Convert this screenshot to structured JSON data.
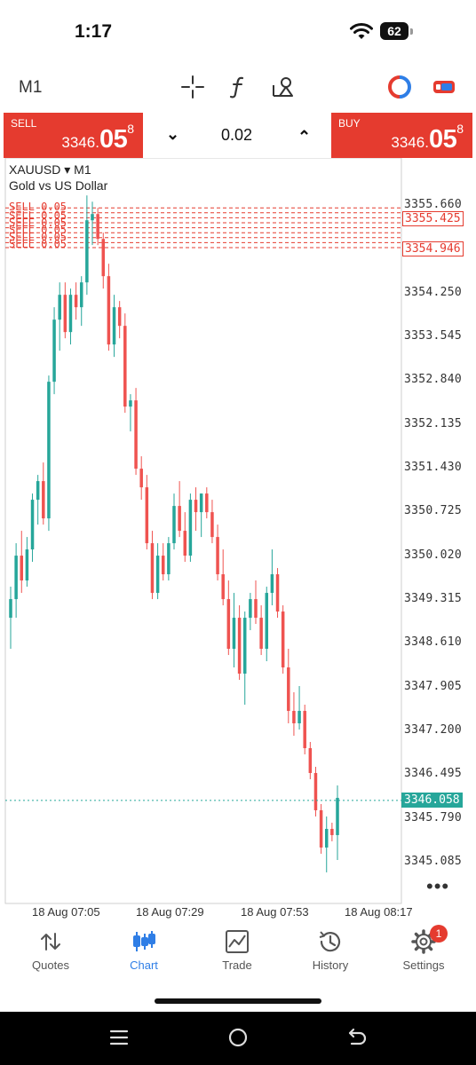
{
  "status": {
    "time": "1:17",
    "battery": "62"
  },
  "toolbar": {
    "timeframe": "M1",
    "icons": [
      "crosshair-icon",
      "function-icon",
      "objects-icon",
      "account-ring-icon",
      "toggle-icon"
    ]
  },
  "trade": {
    "sell": {
      "label": "SELL",
      "price_small": "3346.",
      "price_big": "05",
      "price_sup": "8"
    },
    "buy": {
      "label": "BUY",
      "price_small": "3346.",
      "price_big": "05",
      "price_sup": "8"
    },
    "volume": "0.02"
  },
  "chart": {
    "symbol": "XAUUSD",
    "timeframe": "M1",
    "description": "Gold vs US Dollar",
    "price_axis": [
      "3355.660",
      "3354.250",
      "3353.545",
      "3352.840",
      "3352.135",
      "3351.430",
      "3350.725",
      "3350.020",
      "3349.315",
      "3348.610",
      "3347.905",
      "3347.200",
      "3346.495",
      "3345.790",
      "3345.085"
    ],
    "order_lines": {
      "label": "SELL 0.05",
      "tags": [
        "3355.425",
        "3354.946"
      ]
    },
    "current_price": "3346.058",
    "time_axis": [
      "18 Aug 07:05",
      "18 Aug 07:29",
      "18 Aug 07:53",
      "18 Aug 08:17"
    ],
    "colors": {
      "up": "#26a69a",
      "down": "#ef5350",
      "order": "#e53b2f",
      "current": "#26a69a"
    }
  },
  "chart_data": {
    "type": "candlestick",
    "ylim": [
      3344.7,
      3356.0
    ],
    "candles": [
      [
        3349.0,
        3349.5,
        3348.5,
        3349.3
      ],
      [
        3349.3,
        3350.2,
        3349.0,
        3350.0
      ],
      [
        3350.0,
        3350.4,
        3349.4,
        3349.6
      ],
      [
        3349.6,
        3350.3,
        3349.5,
        3350.1
      ],
      [
        3350.1,
        3351.0,
        3349.9,
        3350.9
      ],
      [
        3350.9,
        3351.3,
        3350.5,
        3351.2
      ],
      [
        3351.2,
        3351.5,
        3350.5,
        3350.6
      ],
      [
        3350.6,
        3352.9,
        3350.4,
        3352.8
      ],
      [
        3352.8,
        3354.0,
        3352.6,
        3353.8
      ],
      [
        3353.8,
        3354.4,
        3353.3,
        3354.2
      ],
      [
        3354.2,
        3354.4,
        3353.5,
        3353.6
      ],
      [
        3353.6,
        3354.3,
        3353.4,
        3354.2
      ],
      [
        3354.2,
        3354.4,
        3353.8,
        3354.0
      ],
      [
        3354.0,
        3354.5,
        3353.7,
        3354.4
      ],
      [
        3354.4,
        3355.8,
        3354.2,
        3355.4
      ],
      [
        3355.4,
        3355.7,
        3355.0,
        3355.5
      ],
      [
        3355.5,
        3355.6,
        3355.0,
        3355.1
      ],
      [
        3355.1,
        3355.2,
        3354.3,
        3354.5
      ],
      [
        3354.5,
        3354.7,
        3353.3,
        3353.4
      ],
      [
        3353.4,
        3354.2,
        3353.2,
        3354.0
      ],
      [
        3354.0,
        3354.1,
        3353.5,
        3353.7
      ],
      [
        3353.7,
        3353.9,
        3352.3,
        3352.4
      ],
      [
        3352.4,
        3352.6,
        3352.0,
        3352.5
      ],
      [
        3352.5,
        3352.7,
        3351.3,
        3351.4
      ],
      [
        3351.4,
        3351.6,
        3350.9,
        3351.1
      ],
      [
        3351.1,
        3351.3,
        3350.1,
        3350.2
      ],
      [
        3350.2,
        3350.4,
        3349.3,
        3349.4
      ],
      [
        3349.4,
        3350.2,
        3349.3,
        3350.0
      ],
      [
        3350.0,
        3350.2,
        3349.6,
        3349.7
      ],
      [
        3349.7,
        3350.3,
        3349.6,
        3350.2
      ],
      [
        3350.2,
        3351.0,
        3350.1,
        3350.8
      ],
      [
        3350.8,
        3351.2,
        3350.3,
        3350.4
      ],
      [
        3350.4,
        3350.7,
        3349.9,
        3350.0
      ],
      [
        3350.0,
        3351.0,
        3349.9,
        3350.9
      ],
      [
        3350.9,
        3351.1,
        3350.4,
        3350.7
      ],
      [
        3350.7,
        3351.0,
        3350.3,
        3351.0
      ],
      [
        3351.0,
        3351.1,
        3350.6,
        3350.7
      ],
      [
        3350.7,
        3350.9,
        3350.2,
        3350.3
      ],
      [
        3350.3,
        3350.5,
        3349.6,
        3349.7
      ],
      [
        3349.7,
        3350.1,
        3349.2,
        3349.3
      ],
      [
        3349.3,
        3349.6,
        3348.4,
        3348.5
      ],
      [
        3348.5,
        3349.4,
        3348.2,
        3349.0
      ],
      [
        3349.0,
        3349.2,
        3348.0,
        3348.1
      ],
      [
        3348.1,
        3349.1,
        3347.6,
        3349.0
      ],
      [
        3349.0,
        3349.4,
        3348.8,
        3349.3
      ],
      [
        3349.3,
        3349.6,
        3348.9,
        3349.0
      ],
      [
        3349.0,
        3349.2,
        3348.4,
        3348.5
      ],
      [
        3348.5,
        3349.5,
        3348.3,
        3349.4
      ],
      [
        3349.4,
        3350.1,
        3349.2,
        3349.7
      ],
      [
        3349.7,
        3349.8,
        3349.0,
        3349.1
      ],
      [
        3349.1,
        3349.2,
        3348.1,
        3348.2
      ],
      [
        3348.2,
        3348.5,
        3347.3,
        3347.5
      ],
      [
        3347.5,
        3347.8,
        3347.1,
        3347.3
      ],
      [
        3347.3,
        3347.9,
        3347.2,
        3347.5
      ],
      [
        3347.5,
        3347.6,
        3346.8,
        3346.9
      ],
      [
        3346.9,
        3347.0,
        3346.4,
        3346.5
      ],
      [
        3346.5,
        3346.6,
        3345.8,
        3345.9
      ],
      [
        3345.9,
        3346.0,
        3345.2,
        3345.3
      ],
      [
        3345.3,
        3345.8,
        3344.9,
        3345.6
      ],
      [
        3345.6,
        3345.7,
        3345.4,
        3345.5
      ],
      [
        3345.5,
        3346.3,
        3345.1,
        3346.1
      ]
    ]
  },
  "nav": {
    "items": [
      {
        "label": "Quotes",
        "icon": "quotes-icon"
      },
      {
        "label": "Chart",
        "icon": "chart-icon"
      },
      {
        "label": "Trade",
        "icon": "trade-icon"
      },
      {
        "label": "History",
        "icon": "history-icon"
      },
      {
        "label": "Settings",
        "icon": "settings-icon",
        "badge": "1"
      }
    ]
  }
}
